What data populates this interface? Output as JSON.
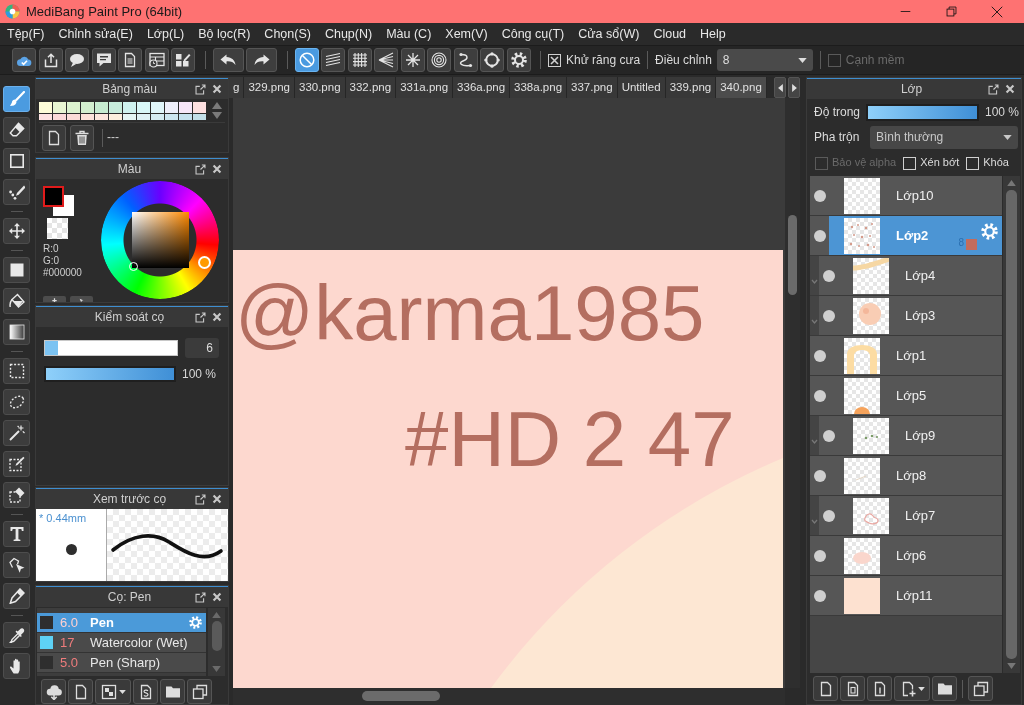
{
  "window": {
    "title": "MediBang Paint Pro (64bit)"
  },
  "menu": [
    "Tệp(F)",
    "Chỉnh sửa(E)",
    "Lớp(L)",
    "Bộ lọc(R)",
    "Chọn(S)",
    "Chụp(N)",
    "Màu (C)",
    "Xem(V)",
    "Công cụ(T)",
    "Cửa sổ(W)",
    "Cloud",
    "Help"
  ],
  "toolbar": {
    "file_buttons": [
      {
        "kind": "cloud"
      },
      {
        "kind": "share"
      },
      {
        "kind": "bubble"
      },
      {
        "kind": "comment"
      },
      {
        "kind": "document"
      },
      {
        "kind": "schedule"
      },
      {
        "kind": "layout"
      }
    ],
    "history_buttons": [
      {
        "kind": "undo"
      },
      {
        "kind": "redo"
      }
    ],
    "snap_buttons": [
      {
        "kind": "none",
        "selected": true
      },
      {
        "kind": "parallel",
        "selected": false
      },
      {
        "kind": "grid",
        "selected": false
      },
      {
        "kind": "perspective",
        "selected": false
      },
      {
        "kind": "radial",
        "selected": false
      },
      {
        "kind": "concentric",
        "selected": false
      },
      {
        "kind": "curve",
        "selected": false
      },
      {
        "kind": "circle",
        "selected": false
      },
      {
        "kind": "gear",
        "selected": false
      }
    ],
    "antialias": {
      "label": "Khử răng cưa",
      "checked": true
    },
    "adjust": {
      "label": "Điều chỉnh",
      "value": "8"
    },
    "soft_edge": {
      "label": "Cạnh mềm",
      "checked": false,
      "disabled": true
    }
  },
  "tool_groups": [
    {
      "tools": [
        {
          "kind": "brush",
          "selected": true
        },
        {
          "kind": "eraser",
          "selected": false
        },
        {
          "kind": "square",
          "selected": false
        },
        {
          "kind": "dotpen",
          "selected": false
        }
      ]
    },
    {
      "tools": [
        {
          "kind": "move",
          "selected": false
        }
      ]
    },
    {
      "tools": [
        {
          "kind": "fillrect",
          "selected": false
        },
        {
          "kind": "bucket",
          "selected": false
        },
        {
          "kind": "gradient",
          "selected": false
        }
      ]
    },
    {
      "tools": [
        {
          "kind": "rectsel",
          "selected": false
        },
        {
          "kind": "lasso",
          "selected": false
        },
        {
          "kind": "wand",
          "selected": false
        },
        {
          "kind": "selpen",
          "selected": false
        },
        {
          "kind": "seleraser",
          "selected": false
        }
      ]
    },
    {
      "tools": [
        {
          "kind": "text",
          "selected": false
        },
        {
          "kind": "operation",
          "selected": false
        },
        {
          "kind": "blade",
          "selected": false
        }
      ]
    },
    {
      "tools": [
        {
          "kind": "dropper",
          "selected": false
        },
        {
          "kind": "hand",
          "selected": false
        }
      ]
    }
  ],
  "palette_panel": {
    "title": "Bảng màu",
    "swatches": [
      {
        "color": "#fdfcd8"
      },
      {
        "color": "#e8f5d2"
      },
      {
        "color": "#dcf2cf"
      },
      {
        "color": "#d3efcf"
      },
      {
        "color": "#c7ecd0"
      },
      {
        "color": "#c8eddc"
      },
      {
        "color": "#cff3ef"
      },
      {
        "color": "#d8f7f7"
      },
      {
        "color": "#e0f6fa"
      },
      {
        "color": "#eeeffa"
      },
      {
        "color": "#f6e6f8"
      },
      {
        "color": "#fde0e0"
      },
      {
        "color": "#fde2e2"
      },
      {
        "color": "#fbd9d9"
      },
      {
        "color": "#fcdcd8"
      },
      {
        "color": "#fde2da"
      },
      {
        "color": "#fde6dc"
      },
      {
        "color": "#fdf0de"
      },
      {
        "color": "#e5f6f4"
      },
      {
        "color": "#dff2f5"
      },
      {
        "color": "#d5ecf2"
      },
      {
        "color": "#cde6f0"
      },
      {
        "color": "#c6e1ee"
      },
      {
        "color": "#c3dfe8"
      }
    ],
    "palette_name": "---"
  },
  "color_panel": {
    "title": "Màu",
    "swatches": [
      {
        "kind": "foreground",
        "color": "#000000"
      },
      {
        "kind": "background",
        "color": "#ffffff"
      }
    ],
    "readouts": [
      "R:0",
      "G:0",
      "#000000"
    ]
  },
  "brush_control": {
    "title": "Kiểm soát cọ",
    "size": {
      "level": 0.1,
      "value": "6"
    },
    "opacity": {
      "level": 1,
      "value": "100 %"
    }
  },
  "brush_preview": {
    "title": "Xem trước cọ",
    "size_label": "* 0.44mm"
  },
  "brush_panel": {
    "title": "Cọ: Pen",
    "brushes": [
      {
        "size": "6.0",
        "name": "Pen",
        "color": "#2e2e2e",
        "selected": true
      },
      {
        "size": "17",
        "name": "Watercolor (Wet)",
        "color": "#5ed2f5",
        "selected": false
      },
      {
        "size": "5.0",
        "name": "Pen (Sharp)",
        "color": "#2e2e2e",
        "selected": false
      }
    ]
  },
  "tabs": [
    {
      "label": "g",
      "selected": false
    },
    {
      "label": "329.png",
      "selected": false
    },
    {
      "label": "330.png",
      "selected": false
    },
    {
      "label": "332.png",
      "selected": false
    },
    {
      "label": "331a.png",
      "selected": false
    },
    {
      "label": "336a.png",
      "selected": false
    },
    {
      "label": "338a.png",
      "selected": false
    },
    {
      "label": "337.png",
      "selected": false
    },
    {
      "label": "Untitled",
      "selected": false
    },
    {
      "label": "339.png",
      "selected": false
    },
    {
      "label": "340.png",
      "selected": true
    }
  ],
  "canvas": {
    "handwriting": [
      "@karma1985",
      "#HD 2 47"
    ]
  },
  "layer_panel": {
    "title": "Lớp",
    "opacity": {
      "label": "Độ trong",
      "level": 1,
      "value": "100 %"
    },
    "blend": {
      "label": "Pha trộn",
      "value": "Bình thường"
    },
    "options": [
      {
        "label": "Bảo vệ alpha",
        "checked": false,
        "disabled": true
      },
      {
        "label": "Xén bớt",
        "checked": false,
        "disabled": false
      },
      {
        "label": "Khóa",
        "checked": false,
        "disabled": false
      }
    ],
    "layers": [
      {
        "name": "Lớp10",
        "selected": false,
        "clipped": false
      },
      {
        "name": "Lớp2",
        "selected": true,
        "clipped": false,
        "badge": "8",
        "color": "#c26c5c"
      },
      {
        "name": "Lớp4",
        "selected": false,
        "clipped": true
      },
      {
        "name": "Lớp3",
        "selected": false,
        "clipped": true
      },
      {
        "name": "Lớp1",
        "selected": false,
        "clipped": false
      },
      {
        "name": "Lớp5",
        "selected": false,
        "clipped": false
      },
      {
        "name": "Lớp9",
        "selected": false,
        "clipped": true
      },
      {
        "name": "Lớp8",
        "selected": false,
        "clipped": false
      },
      {
        "name": "Lớp7",
        "selected": false,
        "clipped": true
      },
      {
        "name": "Lớp6",
        "selected": false,
        "clipped": false
      },
      {
        "name": "Lớp11",
        "selected": false,
        "clipped": false
      }
    ]
  }
}
